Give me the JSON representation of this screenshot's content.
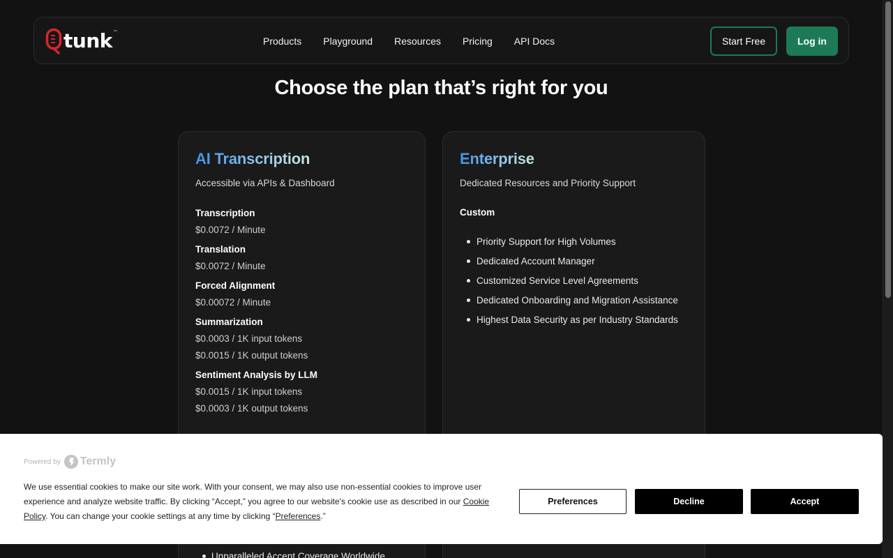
{
  "brand": {
    "name": "tunk",
    "trademark": "™"
  },
  "nav": {
    "links": [
      "Products",
      "Playground",
      "Resources",
      "Pricing",
      "API Docs"
    ],
    "start_free": "Start Free",
    "login": "Log in"
  },
  "page": {
    "title": "Choose the plan that’s right for you"
  },
  "plans": {
    "ai": {
      "title": "AI Transcription",
      "subtitle": "Accessible via APIs & Dashboard",
      "features": [
        {
          "name": "Transcription",
          "prices": [
            "$0.0072 / Minute"
          ]
        },
        {
          "name": "Translation",
          "prices": [
            "$0.0072 / Minute"
          ]
        },
        {
          "name": "Forced Alignment",
          "prices": [
            "$0.00072 / Minute"
          ]
        },
        {
          "name": "Summarization",
          "prices": [
            "$0.0003 / 1K input tokens",
            "$0.0015 / 1K output tokens"
          ]
        },
        {
          "name": "Sentiment Analysis by LLM",
          "prices": [
            "$0.0015 / 1K input tokens",
            "$0.0003 / 1K output tokens"
          ]
        }
      ],
      "bottom_item": "Unparalleled Accent Coverage Worldwide"
    },
    "enterprise": {
      "title": "Enterprise",
      "subtitle": "Dedicated Resources and Priority Support",
      "price": "Custom",
      "items": [
        "Priority Support for High Volumes",
        "Dedicated Account Manager",
        "Customized Service Level Agreements",
        "Dedicated Onboarding and Migration Assistance",
        "Highest Data Security as per Industry Standards"
      ]
    }
  },
  "cookie": {
    "powered_by": "Powered by",
    "provider": "Termly",
    "text_part1": "We use essential cookies to make our site work. With your consent, we may also use non-essential cookies to improve user experience and analyze website traffic. By clicking “Accept,” you agree to our website's cookie use as described in our ",
    "policy_link": "Cookie Policy",
    "text_part2": ". You can change your cookie settings at any time by clicking “",
    "preferences_link": "Preferences",
    "text_part3": ".”",
    "buttons": {
      "preferences": "Preferences",
      "decline": "Decline",
      "accept": "Accept"
    }
  },
  "colors": {
    "background": "#121212",
    "accent_green": "#1c7a57",
    "title_gradient": [
      "#3f92e6",
      "#8fc4ec",
      "#c9e9d6"
    ],
    "logo_red": "#d9262c"
  },
  "icons": {
    "logo": "tunk-logo-mark",
    "termly": "termly-logo-icon",
    "bullet": "bullet-dot"
  }
}
